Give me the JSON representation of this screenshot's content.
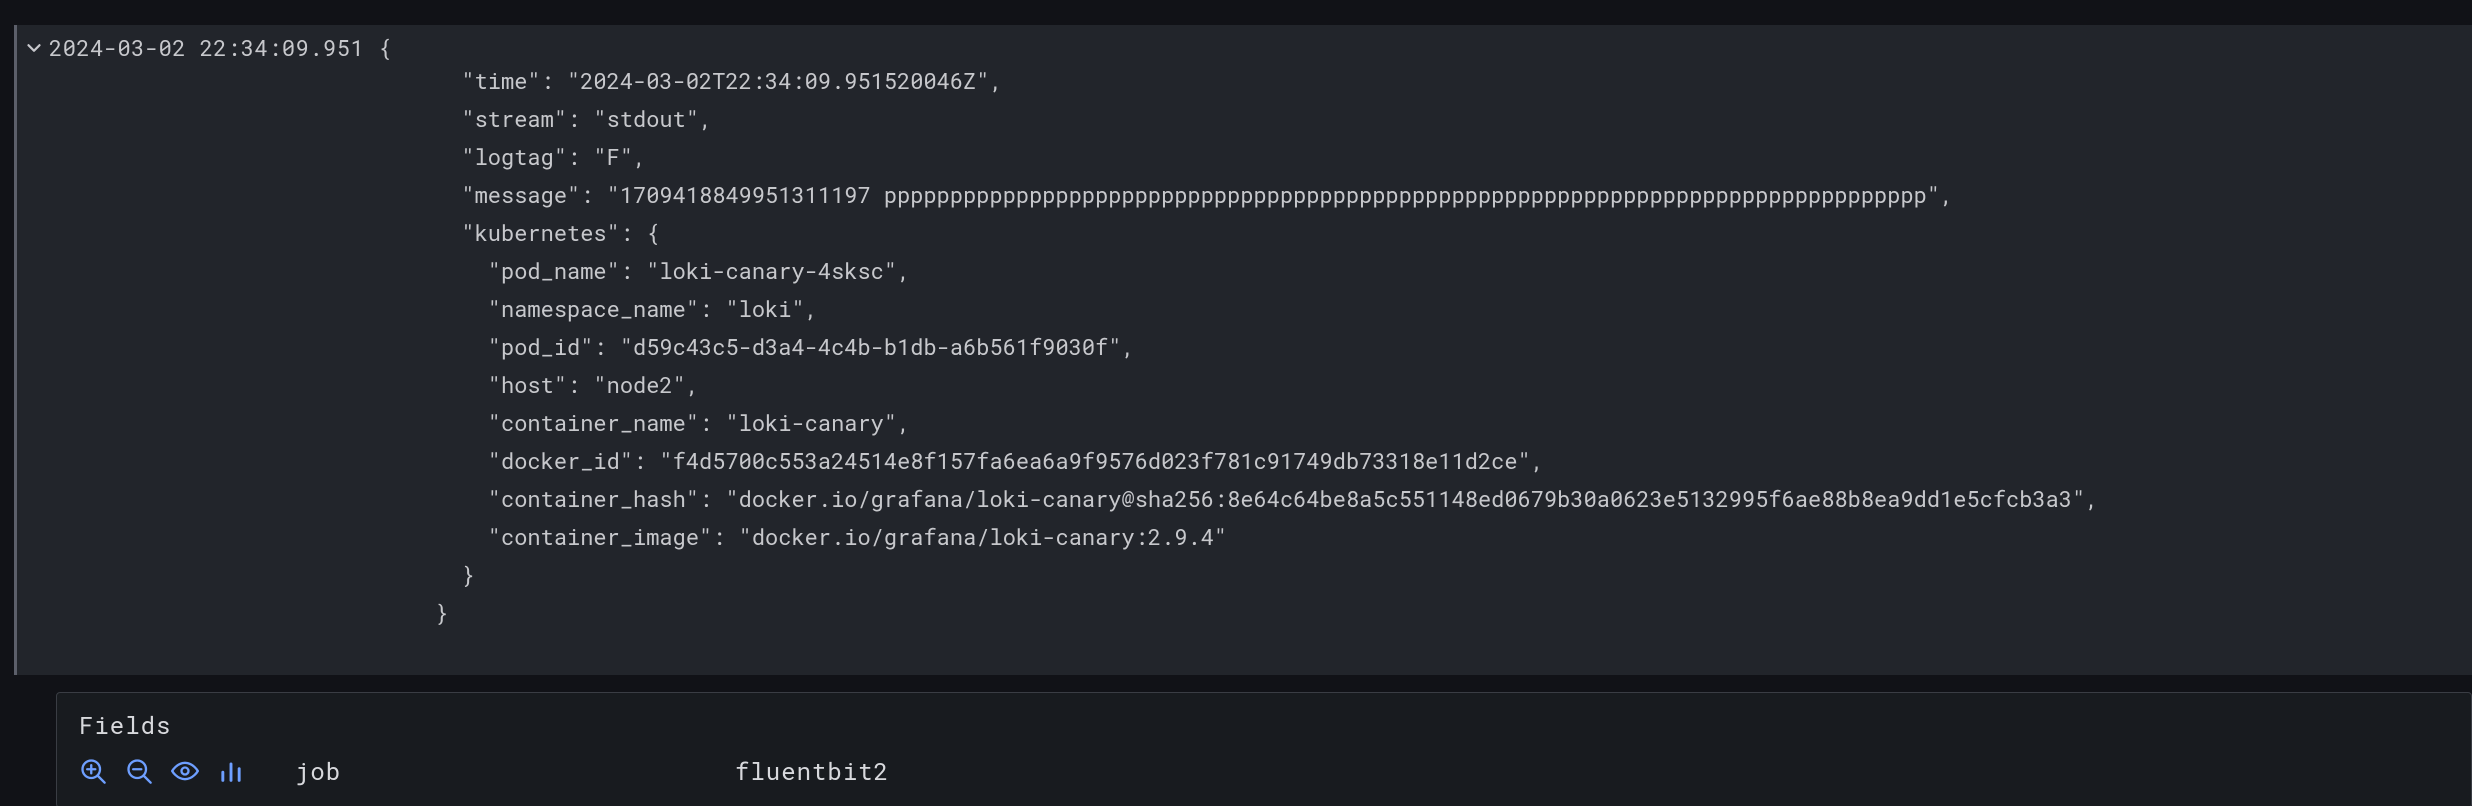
{
  "log": {
    "timestamp": "2024-03-02 22:34:09.951",
    "json": {
      "open_brace": "{",
      "lines": [
        "  \"time\": \"2024-03-02T22:34:09.951520046Z\",",
        "  \"stream\": \"stdout\",",
        "  \"logtag\": \"F\",",
        "  \"message\": \"1709418849951311197 ppppppppppppppppppppppppppppppppppppppppppppppppppppppppppppppppppppppppppppppp\",",
        "  \"kubernetes\": {",
        "    \"pod_name\": \"loki-canary-4sksc\",",
        "    \"namespace_name\": \"loki\",",
        "    \"pod_id\": \"d59c43c5-d3a4-4c4b-b1db-a6b561f9030f\",",
        "    \"host\": \"node2\",",
        "    \"container_name\": \"loki-canary\",",
        "    \"docker_id\": \"f4d5700c553a24514e8f157fa6ea6a9f9576d023f781c91749db73318e11d2ce\",",
        "    \"container_hash\": \"docker.io/grafana/loki-canary@sha256:8e64c64be8a5c551148ed0679b30a0623e5132995f6ae88b8ea9dd1e5cfcb3a3\",",
        "    \"container_image\": \"docker.io/grafana/loki-canary:2.9.4\"",
        "  }",
        "}"
      ]
    }
  },
  "fields": {
    "title": "Fields",
    "rows": [
      {
        "key": "job",
        "value": "fluentbit2"
      }
    ]
  }
}
